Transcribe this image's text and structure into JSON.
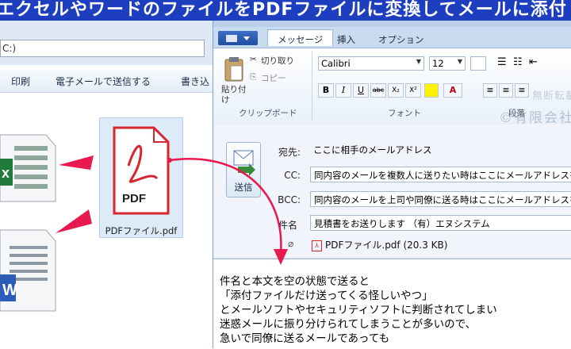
{
  "banner": {
    "text": "エクセルやワードのファイルをPDFファイルに変換してメールに添付"
  },
  "explorer": {
    "address_text": "C:)",
    "commands": [
      "印刷",
      "電子メールで送信する",
      "書き込"
    ],
    "pdf_label": "PDFファイル.pdf",
    "pdf_badge": "PDF"
  },
  "outlook": {
    "tabs": [
      "メッセージ",
      "挿入",
      "オプション"
    ],
    "clipboard": {
      "paste": "貼り付け",
      "cut": "切り取り",
      "copy": "コピー",
      "group_label": "クリップボード"
    },
    "font": {
      "name": "Calibri",
      "size": "12",
      "group_label": "フォント"
    },
    "paragraph_group_label": "段落",
    "format_buttons": [
      "B",
      "I",
      "U",
      "abc",
      "X₂",
      "X²"
    ],
    "watermark": "©有限会社エヌシステム",
    "watermark_extra": "無断転載禁止",
    "send_label": "送信",
    "fields": [
      {
        "label": "宛先:",
        "value": "ここに相手のメールアドレス"
      },
      {
        "label": "CC:",
        "value": "同内容のメールを複数人に送りたい時はここにメールアドレスを追加"
      },
      {
        "label": "BCC:",
        "value": "同内容のメールを上司や同僚に送る時はここにメールアドレスを追加"
      },
      {
        "label": "件名",
        "value": "見積書をお送りします （有）エヌシステム"
      }
    ],
    "attachment": "PDFファイル.pdf (20.3 KB)",
    "body_lines": [
      "件名と本文を空の状態で送ると",
      "「添付ファイルだけ送ってくる怪しいやつ」",
      "とメールソフトやセキュリティソフトに判断されてしまい",
      "迷惑メールに振り分けられてしまうことが多いので、",
      "急いで同僚に送るメールであっても"
    ]
  },
  "colors": {
    "banner": "#1d3fbf",
    "arrow": "#e8194f",
    "pdf_red": "#d8262e"
  }
}
